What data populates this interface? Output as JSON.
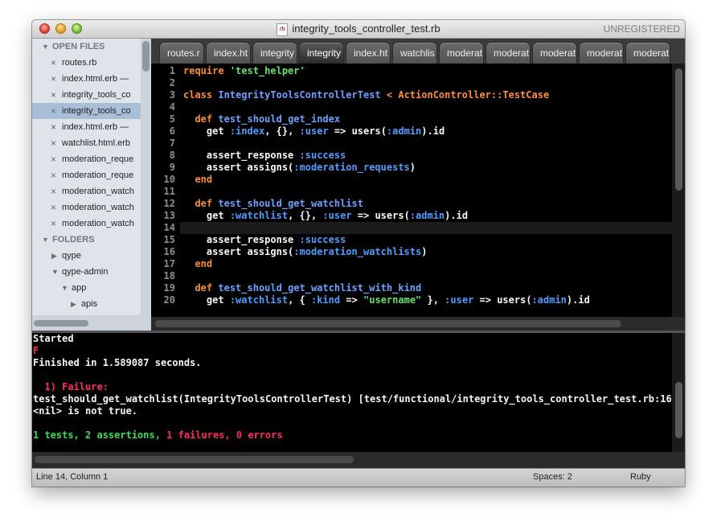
{
  "window": {
    "title": "integrity_tools_controller_test.rb",
    "file_icon": "rb",
    "unregistered": "UNREGISTERED"
  },
  "sidebar": {
    "open_files_header": "OPEN FILES",
    "open_files": [
      "routes.rb",
      "index.html.erb —",
      "integrity_tools_co",
      "integrity_tools_co",
      "index.html.erb —",
      "watchlist.html.erb",
      "moderation_reque",
      "moderation_reque",
      "moderation_watch",
      "moderation_watch",
      "moderation_watch"
    ],
    "selected_index": 3,
    "folders_header": "FOLDERS",
    "folders": [
      {
        "label": "qype",
        "expanded": false
      },
      {
        "label": "qype-admin",
        "expanded": true
      },
      {
        "label": "app",
        "expanded": true
      },
      {
        "label": "apis",
        "expanded": false
      }
    ]
  },
  "tabs": [
    "routes.r",
    "index.ht",
    "integrity",
    "integrity",
    "index.ht",
    "watchlis",
    "moderat",
    "moderat",
    "moderat",
    "moderat",
    "moderat"
  ],
  "active_tab": 3,
  "editor": {
    "current_line": 14,
    "line_numbers": [
      "1",
      "2",
      "3",
      "4",
      "5",
      "6",
      "7",
      "8",
      "9",
      "10",
      "11",
      "12",
      "13",
      "14",
      "15",
      "16",
      "17",
      "18",
      "19",
      "20"
    ],
    "code": {
      "l1_kw": "require",
      "l1_str": "'test_helper'",
      "l3_kw": "class",
      "l3_cls": "IntegrityToolsControllerTest",
      "l3_inh": "< ActionController::TestCase",
      "def": "def",
      "end": "end",
      "l5_fn": "test_should_get_index",
      "l6_a": "get",
      "l6_sym1": ":index",
      "l6_b": ", {}, ",
      "l6_sym2": ":user",
      "l6_c": " => users(",
      "l6_sym3": ":admin",
      "l6_d": ").id",
      "l8_a": "assert_response",
      "l8_sym": ":success",
      "l9_a": "assert assigns(",
      "l9_sym": ":moderation_requests",
      "l9_b": ")",
      "l12_fn": "test_should_get_watchlist",
      "l13_a": "get",
      "l13_sym1": ":watchlist",
      "l13_b": ", {}, ",
      "l13_sym2": ":user",
      "l13_c": " => users(",
      "l13_sym3": ":admin",
      "l13_d": ").id",
      "l15_a": "assert_response",
      "l15_sym": ":success",
      "l16_a": "assert assigns(",
      "l16_sym": ":moderation_watchlists",
      "l16_b": ")",
      "l19_fn": "test_should_get_watchlist_with_kind",
      "l20_a": "get",
      "l20_sym1": ":watchlist",
      "l20_b": ", { ",
      "l20_sym2": ":kind",
      "l20_c": " => ",
      "l20_str": "\"username\"",
      "l20_d": " }, ",
      "l20_sym3": ":user",
      "l20_e": " => users(",
      "l20_sym4": ":admin",
      "l20_f": ").id"
    }
  },
  "output": {
    "started": "Started",
    "progress": "F",
    "finished": "Finished in 1.589087 seconds.",
    "failure": "  1) Failure:",
    "test_line": "test_should_get_watchlist(IntegrityToolsControllerTest) [test/functional/integrity_tools_controller_test.rb:16",
    "message": "<nil> is not true.",
    "summary_tests": "1 tests, 2 assertions, ",
    "summary_failures": "1 failures, ",
    "summary_errors": "0 errors"
  },
  "statusbar": {
    "position": "Line 14, Column 1",
    "spaces": "Spaces: 2",
    "syntax": "Ruby"
  },
  "colors": {
    "keyword": "#fc8d2f",
    "string": "#66e06a",
    "symbol": "#4f9dff",
    "failure": "#ff2a60",
    "pass": "#33e055"
  }
}
